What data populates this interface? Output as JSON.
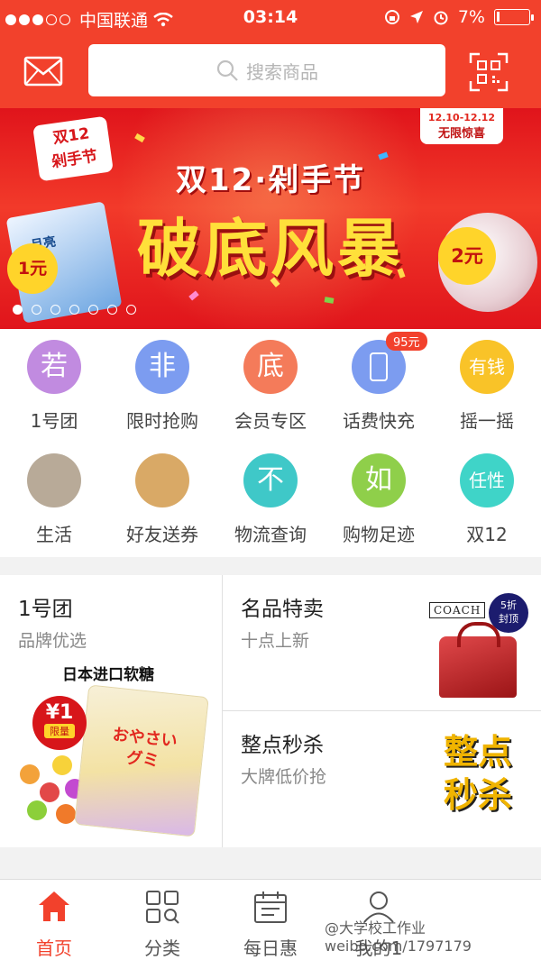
{
  "status_bar": {
    "carrier": "中国联通",
    "time": "03:14",
    "battery": "7%"
  },
  "header": {
    "search_placeholder": "搜索商品"
  },
  "banner": {
    "badge_text": "双12\n剁手节",
    "date_range": "12.10-12.12",
    "date_caption": "无限惊喜",
    "headline": "双12·剁手节",
    "main_slogan": "破底风暴",
    "left_price": "1元",
    "left_product_text": "月亮",
    "right_price": "2元",
    "page_count": 7,
    "active_page": 1
  },
  "quick_grid": [
    {
      "label": "1号团",
      "glyph": "若",
      "color": "#c18be0"
    },
    {
      "label": "限时抢购",
      "glyph": "非",
      "color": "#7c9cf0"
    },
    {
      "label": "会员专区",
      "glyph": "底",
      "color": "#f47b5a"
    },
    {
      "label": "话费快充",
      "glyph": "phone",
      "color": "#7c9cf0",
      "tag": "95元"
    },
    {
      "label": "摇一摇",
      "glyph": "有钱",
      "color": "#f9c328"
    },
    {
      "label": "生活",
      "glyph": "photo-cat",
      "color": "#b8aa98"
    },
    {
      "label": "好友送券",
      "glyph": "photo-dog",
      "color": "#d9a966"
    },
    {
      "label": "物流查询",
      "glyph": "不",
      "color": "#3fc8c8"
    },
    {
      "label": "购物足迹",
      "glyph": "如",
      "color": "#8fcf4a"
    },
    {
      "label": "双12",
      "glyph": "任性",
      "color": "#3fd4c8"
    }
  ],
  "promo": {
    "left": {
      "title": "1号团",
      "subtitle": "品牌优选",
      "product_caption": "日本进口软糖",
      "price": "¥1",
      "price_tag": "限量",
      "bag_text": "おやさい\nグミ"
    },
    "top_right": {
      "title": "名品特卖",
      "subtitle": "十点上新",
      "brand": "COACH",
      "badge": "5折\n封顶"
    },
    "bottom_right": {
      "title": "整点秒杀",
      "subtitle": "大牌低价抢",
      "art_text_1": "整点",
      "art_text_2": "秒杀"
    }
  },
  "tabbar": {
    "items": [
      {
        "label": "首页",
        "active": true
      },
      {
        "label": "分类",
        "active": false
      },
      {
        "label": "每日惠",
        "active": false
      },
      {
        "label": "我的1",
        "active": false
      }
    ]
  },
  "watermark": "@大学校工作业  weibo.com/1797179"
}
